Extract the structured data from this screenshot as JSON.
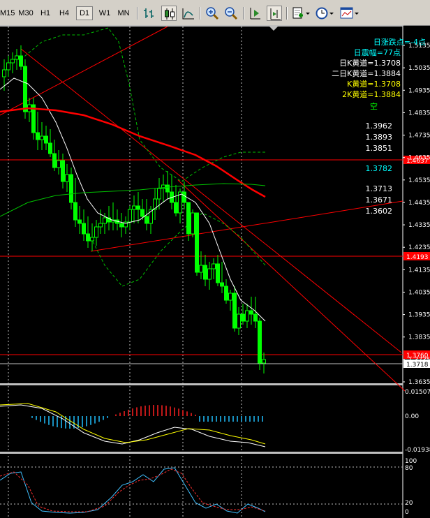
{
  "toolbar": {
    "timeframes": [
      "M15",
      "M30",
      "H1",
      "H4",
      "D1",
      "W1",
      "MN"
    ],
    "active_timeframe": "D1"
  },
  "info": {
    "line1": "日涨跌点=-4点",
    "line2": "日震幅=77点",
    "line3": "日K黄道=1.3708",
    "line4": "二日K黄道=1.3884",
    "line5": "K黄道=1.3708",
    "line6": "2K黄道=1.3884",
    "line7": "空"
  },
  "levels": {
    "a": "1.3962",
    "b": "1.3893",
    "c": "1.3851",
    "d": "1.3782",
    "e": "1.3713",
    "f": "1.3671",
    "g": "1.3602"
  },
  "price_axis": {
    "ticks": [
      "1.5135",
      "1.5035",
      "1.4935",
      "1.4835",
      "1.4735",
      "1.4635",
      "1.4535",
      "1.4435",
      "1.4335",
      "1.4235",
      "1.4135",
      "1.4035",
      "1.3935",
      "1.3835",
      "1.3735",
      "1.3635"
    ],
    "tag_upper": "1.4637",
    "tag_middle": "1.4193",
    "tag_lower": "1.3760",
    "tag_current": "1.3718"
  },
  "macd_axis": {
    "top": "0.01507",
    "mid": "0.00",
    "bottom": "-0.01938"
  },
  "stoch_axis": {
    "top": "100",
    "upper": "80",
    "lower": "20",
    "bottom": "0"
  },
  "colors": {
    "bull": "#00ff00",
    "bear": "#00ff00",
    "ma_red": "#ff0000",
    "ma_green": "#00c000",
    "ma_white": "#ffffff",
    "info_cyan": "#00ffff",
    "info_yellow": "#ffff00",
    "hline": "#ff0000"
  }
}
